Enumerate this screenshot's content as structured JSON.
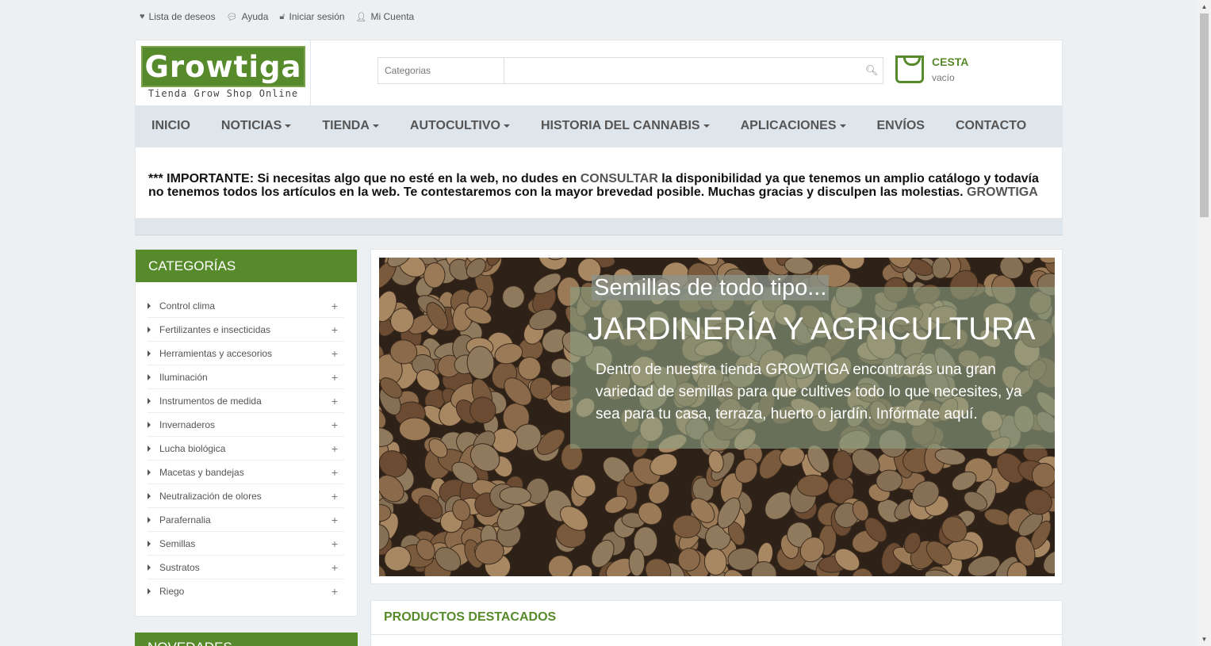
{
  "toplinks": [
    {
      "label": "Lista de deseos",
      "icon": "heart-icon"
    },
    {
      "label": "Ayuda",
      "icon": "chat-icon"
    },
    {
      "label": "Iniciar sesión",
      "icon": "lock-icon"
    },
    {
      "label": "Mi Cuenta",
      "icon": "user-icon"
    }
  ],
  "logo": {
    "brand": "Growtiga",
    "tagline": "Tienda Grow Shop Online"
  },
  "search": {
    "category_placeholder": "Categorias",
    "query": ""
  },
  "cart": {
    "label": "CESTA",
    "state": "vacío"
  },
  "nav": [
    {
      "label": "INICIO",
      "dropdown": false
    },
    {
      "label": "NOTICIAS",
      "dropdown": true
    },
    {
      "label": "TIENDA",
      "dropdown": true
    },
    {
      "label": "AUTOCULTIVO",
      "dropdown": true
    },
    {
      "label": "HISTORIA DEL CANNABIS",
      "dropdown": true
    },
    {
      "label": "APLICACIONES",
      "dropdown": true
    },
    {
      "label": "ENVÍOS",
      "dropdown": false
    },
    {
      "label": "CONTACTO",
      "dropdown": false
    }
  ],
  "notice": {
    "part1": "*** IMPORTANTE: Si necesitas algo que no esté en la web, no dudes en ",
    "link1": "CONSULTAR",
    "part2": " la disponibilidad ya que tenemos un amplio catálogo y todavía no tenemos todos los artículos en la web. Te contestaremos con la mayor brevedad posible. Muchas gracias y disculpen las molestias. ",
    "link2": "GROWTIGA"
  },
  "sidebar": {
    "title": "CATEGORÍAS",
    "items": [
      "Control clima",
      "Fertilizantes e insecticidas",
      "Herramientas y accesorios",
      "Iluminación",
      "Instrumentos de medida",
      "Invernaderos",
      "Lucha biológica",
      "Macetas y bandejas",
      "Neutralización de olores",
      "Parafernalia",
      "Semillas",
      "Sustratos",
      "Riego"
    ],
    "next_title": "NOVEDADES"
  },
  "slider": {
    "kicker": "Semillas de todo tipo...",
    "title": "JARDINERÍA Y AGRICULTURA",
    "text": "Dentro de nuestra tienda GROWTIGA encontrarás una gran variedad de semillas para que cultives todo lo que necesites, ya sea para tu casa, terraza, huerto o jardín. Infórmate aquí."
  },
  "featured": {
    "title": "PRODUCTOS DESTACADOS"
  },
  "colors": {
    "brand_green": "#578a2b",
    "nav_bg": "#dfe6eb",
    "page_bg": "#ecf0f3"
  }
}
